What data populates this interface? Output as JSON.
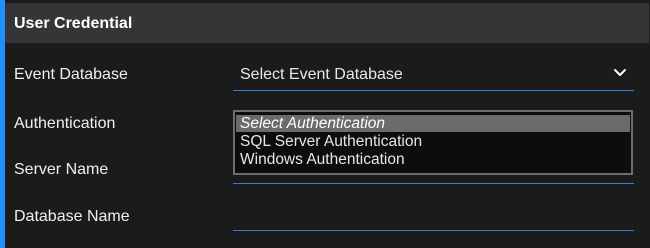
{
  "header": {
    "title": "User Credential"
  },
  "fields": {
    "event_database": {
      "label": "Event Database",
      "value": "Select Event Database"
    },
    "authentication": {
      "label": "Authentication",
      "options": [
        "Select Authentication",
        "SQL Server Authentication",
        "Windows Authentication"
      ],
      "selected": "Select Authentication"
    },
    "server_name": {
      "label": "Server Name",
      "value": ""
    },
    "database_name": {
      "label": "Database Name",
      "value": ""
    }
  },
  "icons": {
    "event_database_dropdown": "chevron-down-icon"
  },
  "colors": {
    "accent": "#1e90ff",
    "underline": "#2f80d1",
    "header_bg": "#333536",
    "page_bg": "#1b1b1b",
    "selected_option_bg": "#6b6b6b"
  }
}
